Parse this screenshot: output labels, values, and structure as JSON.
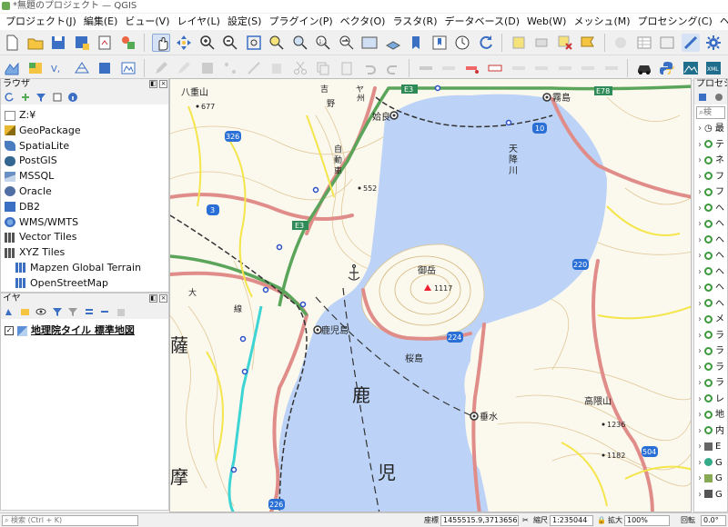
{
  "window": {
    "title": "*無題のプロジェクト — QGIS"
  },
  "menu": {
    "items": [
      "プロジェクト(J)",
      "編集(E)",
      "ビュー(V)",
      "レイヤ(L)",
      "設定(S)",
      "プラグイン(P)",
      "ベクタ(O)",
      "ラスタ(R)",
      "データベース(D)",
      "Web(W)",
      "メッシュ(M)",
      "プロセシング(C)",
      "ヘルプ(H)"
    ]
  },
  "browser": {
    "title": "ラウザ",
    "items": [
      {
        "label": "Z:¥",
        "icon": "folder-icon"
      },
      {
        "label": "GeoPackage",
        "icon": "geopackage-icon"
      },
      {
        "label": "SpatiaLite",
        "icon": "spatialite-icon"
      },
      {
        "label": "PostGIS",
        "icon": "postgis-icon"
      },
      {
        "label": "MSSQL",
        "icon": "mssql-icon"
      },
      {
        "label": "Oracle",
        "icon": "oracle-icon"
      },
      {
        "label": "DB2",
        "icon": "db2-icon"
      },
      {
        "label": "WMS/WMTS",
        "icon": "wms-icon"
      },
      {
        "label": "Vector Tiles",
        "icon": "vector-tiles-icon"
      },
      {
        "label": "XYZ Tiles",
        "icon": "xyz-tiles-icon"
      },
      {
        "label": "Mapzen Global Terrain",
        "icon": "tile-grid-icon",
        "sub": true
      },
      {
        "label": "OpenStreetMap",
        "icon": "tile-grid-icon",
        "sub": true
      }
    ]
  },
  "layers": {
    "title": "イヤ",
    "items": [
      {
        "label": "地理院タイル 標準地図",
        "checked": true,
        "check_mark": "✓"
      }
    ]
  },
  "processing": {
    "title": "プロセシ",
    "search_placeholder": "検",
    "rows": [
      "最",
      "テ",
      "ネ",
      "フ",
      "フ",
      "ヘ",
      "ヘ",
      "ヘ",
      "ヘ",
      "ヘ",
      "ヘ",
      "ヘ",
      "メ",
      "ラ",
      "ラ",
      "ラ",
      "ラ",
      "レ",
      "地",
      "内",
      "E",
      "G",
      "G",
      "G"
    ]
  },
  "map": {
    "places": [
      "八重山",
      "霧島",
      "姶良",
      "天降川",
      "鹿児島",
      "桜島",
      "御岳",
      "垂水",
      "高隈山",
      "鹿",
      "児",
      "薩",
      "摩",
      "吉",
      "野",
      "ヤ",
      "州",
      "自",
      "動",
      "車",
      "大",
      "線"
    ],
    "elevations": [
      "677",
      "552",
      "1117",
      "1236",
      "1182"
    ],
    "roads": [
      "E3",
      "E3",
      "E78",
      "10",
      "326",
      "3",
      "220",
      "224",
      "504",
      "226"
    ]
  },
  "status": {
    "search_placeholder": "検索 (Ctrl + K)",
    "coord_label": "座標",
    "coord_value": "1455515.9,3713656",
    "scale_label": "縮尺",
    "scale_value": "1:235044",
    "zoom_label": "拡大",
    "zoom_value": "100%",
    "rotation_label": "回転",
    "rotation_value": "0.0°"
  },
  "colors": {
    "water": "#bcd3f7",
    "land": "#fbf8ee",
    "road_major": "#e08d8a",
    "road_minor": "#f4e64a",
    "expressway": "#5aa55a",
    "contour": "#e1c898"
  }
}
